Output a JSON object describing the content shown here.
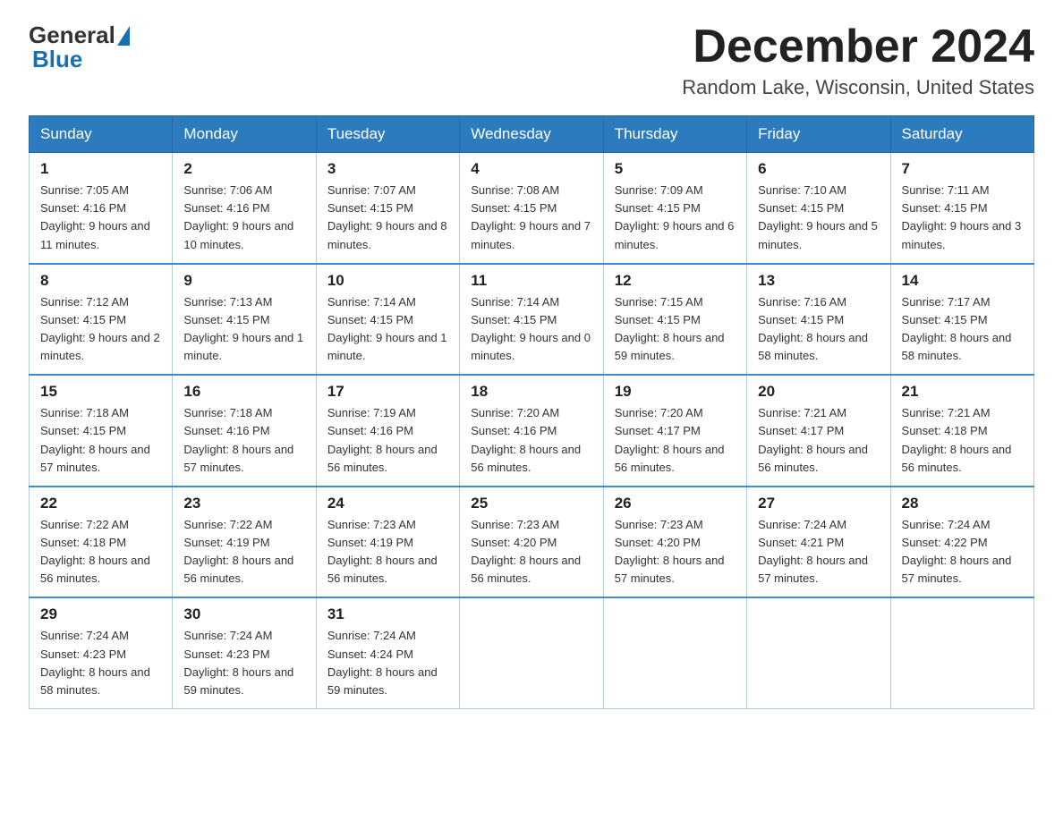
{
  "header": {
    "logo_general": "General",
    "logo_blue": "Blue",
    "month_title": "December 2024",
    "location": "Random Lake, Wisconsin, United States"
  },
  "days_of_week": [
    "Sunday",
    "Monday",
    "Tuesday",
    "Wednesday",
    "Thursday",
    "Friday",
    "Saturday"
  ],
  "weeks": [
    [
      {
        "day": "1",
        "sunrise": "7:05 AM",
        "sunset": "4:16 PM",
        "daylight": "9 hours and 11 minutes."
      },
      {
        "day": "2",
        "sunrise": "7:06 AM",
        "sunset": "4:16 PM",
        "daylight": "9 hours and 10 minutes."
      },
      {
        "day": "3",
        "sunrise": "7:07 AM",
        "sunset": "4:15 PM",
        "daylight": "9 hours and 8 minutes."
      },
      {
        "day": "4",
        "sunrise": "7:08 AM",
        "sunset": "4:15 PM",
        "daylight": "9 hours and 7 minutes."
      },
      {
        "day": "5",
        "sunrise": "7:09 AM",
        "sunset": "4:15 PM",
        "daylight": "9 hours and 6 minutes."
      },
      {
        "day": "6",
        "sunrise": "7:10 AM",
        "sunset": "4:15 PM",
        "daylight": "9 hours and 5 minutes."
      },
      {
        "day": "7",
        "sunrise": "7:11 AM",
        "sunset": "4:15 PM",
        "daylight": "9 hours and 3 minutes."
      }
    ],
    [
      {
        "day": "8",
        "sunrise": "7:12 AM",
        "sunset": "4:15 PM",
        "daylight": "9 hours and 2 minutes."
      },
      {
        "day": "9",
        "sunrise": "7:13 AM",
        "sunset": "4:15 PM",
        "daylight": "9 hours and 1 minute."
      },
      {
        "day": "10",
        "sunrise": "7:14 AM",
        "sunset": "4:15 PM",
        "daylight": "9 hours and 1 minute."
      },
      {
        "day": "11",
        "sunrise": "7:14 AM",
        "sunset": "4:15 PM",
        "daylight": "9 hours and 0 minutes."
      },
      {
        "day": "12",
        "sunrise": "7:15 AM",
        "sunset": "4:15 PM",
        "daylight": "8 hours and 59 minutes."
      },
      {
        "day": "13",
        "sunrise": "7:16 AM",
        "sunset": "4:15 PM",
        "daylight": "8 hours and 58 minutes."
      },
      {
        "day": "14",
        "sunrise": "7:17 AM",
        "sunset": "4:15 PM",
        "daylight": "8 hours and 58 minutes."
      }
    ],
    [
      {
        "day": "15",
        "sunrise": "7:18 AM",
        "sunset": "4:15 PM",
        "daylight": "8 hours and 57 minutes."
      },
      {
        "day": "16",
        "sunrise": "7:18 AM",
        "sunset": "4:16 PM",
        "daylight": "8 hours and 57 minutes."
      },
      {
        "day": "17",
        "sunrise": "7:19 AM",
        "sunset": "4:16 PM",
        "daylight": "8 hours and 56 minutes."
      },
      {
        "day": "18",
        "sunrise": "7:20 AM",
        "sunset": "4:16 PM",
        "daylight": "8 hours and 56 minutes."
      },
      {
        "day": "19",
        "sunrise": "7:20 AM",
        "sunset": "4:17 PM",
        "daylight": "8 hours and 56 minutes."
      },
      {
        "day": "20",
        "sunrise": "7:21 AM",
        "sunset": "4:17 PM",
        "daylight": "8 hours and 56 minutes."
      },
      {
        "day": "21",
        "sunrise": "7:21 AM",
        "sunset": "4:18 PM",
        "daylight": "8 hours and 56 minutes."
      }
    ],
    [
      {
        "day": "22",
        "sunrise": "7:22 AM",
        "sunset": "4:18 PM",
        "daylight": "8 hours and 56 minutes."
      },
      {
        "day": "23",
        "sunrise": "7:22 AM",
        "sunset": "4:19 PM",
        "daylight": "8 hours and 56 minutes."
      },
      {
        "day": "24",
        "sunrise": "7:23 AM",
        "sunset": "4:19 PM",
        "daylight": "8 hours and 56 minutes."
      },
      {
        "day": "25",
        "sunrise": "7:23 AM",
        "sunset": "4:20 PM",
        "daylight": "8 hours and 56 minutes."
      },
      {
        "day": "26",
        "sunrise": "7:23 AM",
        "sunset": "4:20 PM",
        "daylight": "8 hours and 57 minutes."
      },
      {
        "day": "27",
        "sunrise": "7:24 AM",
        "sunset": "4:21 PM",
        "daylight": "8 hours and 57 minutes."
      },
      {
        "day": "28",
        "sunrise": "7:24 AM",
        "sunset": "4:22 PM",
        "daylight": "8 hours and 57 minutes."
      }
    ],
    [
      {
        "day": "29",
        "sunrise": "7:24 AM",
        "sunset": "4:23 PM",
        "daylight": "8 hours and 58 minutes."
      },
      {
        "day": "30",
        "sunrise": "7:24 AM",
        "sunset": "4:23 PM",
        "daylight": "8 hours and 59 minutes."
      },
      {
        "day": "31",
        "sunrise": "7:24 AM",
        "sunset": "4:24 PM",
        "daylight": "8 hours and 59 minutes."
      },
      null,
      null,
      null,
      null
    ]
  ]
}
